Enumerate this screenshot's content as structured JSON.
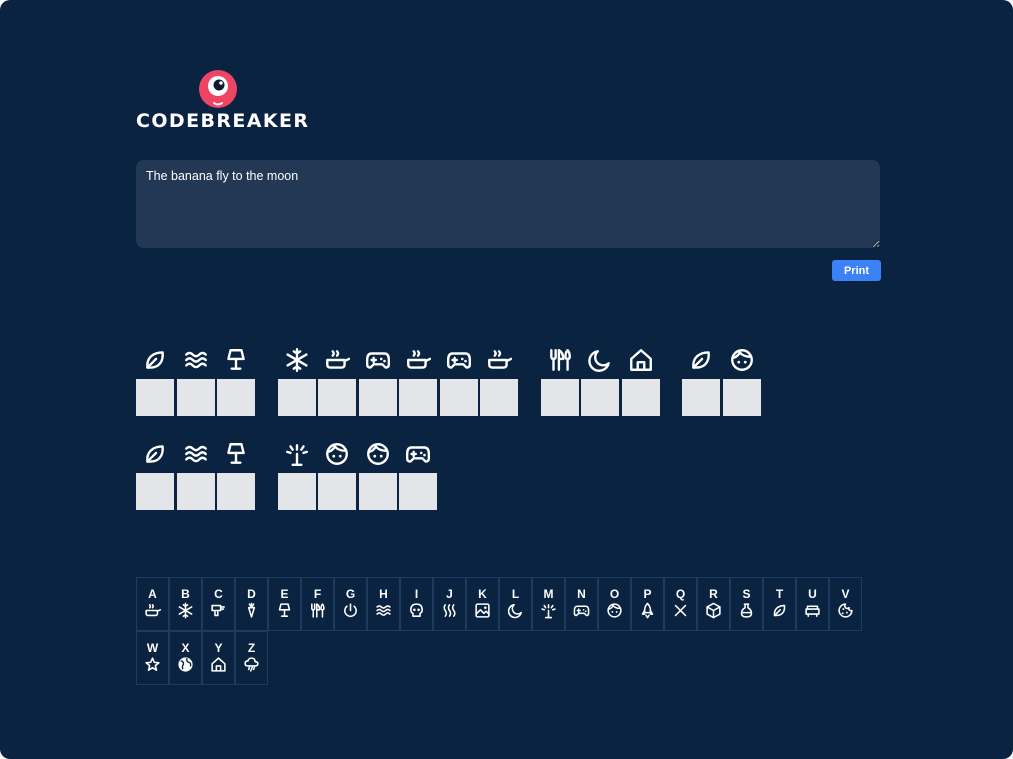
{
  "app": {
    "logo_text": "CODEBREAKER",
    "brand_color": "#ef4565",
    "background": "#092341"
  },
  "composer": {
    "message": "The banana fly to the moon",
    "print_label": "Print",
    "button_color": "#3b82f6"
  },
  "encoded_lines": [
    [
      [
        "leaf",
        "waves",
        "lamp"
      ],
      [
        "snowflake",
        "pot",
        "gamepad",
        "pot",
        "gamepad",
        "pot"
      ],
      [
        "cutlery",
        "moon",
        "house"
      ],
      [
        "leaf",
        "face"
      ]
    ],
    [
      [
        "leaf",
        "waves",
        "lamp"
      ],
      [
        "sprinkler",
        "face",
        "face",
        "gamepad"
      ]
    ]
  ],
  "cipher_key": [
    {
      "letter": "A",
      "icon": "pot"
    },
    {
      "letter": "B",
      "icon": "snowflake"
    },
    {
      "letter": "C",
      "icon": "drill"
    },
    {
      "letter": "D",
      "icon": "carrot"
    },
    {
      "letter": "E",
      "icon": "lamp"
    },
    {
      "letter": "F",
      "icon": "cutlery"
    },
    {
      "letter": "G",
      "icon": "power"
    },
    {
      "letter": "H",
      "icon": "waves"
    },
    {
      "letter": "I",
      "icon": "skull"
    },
    {
      "letter": "J",
      "icon": "heat"
    },
    {
      "letter": "K",
      "icon": "picture"
    },
    {
      "letter": "L",
      "icon": "moon"
    },
    {
      "letter": "M",
      "icon": "sprinkler"
    },
    {
      "letter": "N",
      "icon": "gamepad"
    },
    {
      "letter": "O",
      "icon": "face"
    },
    {
      "letter": "P",
      "icon": "rocket"
    },
    {
      "letter": "Q",
      "icon": "cross"
    },
    {
      "letter": "R",
      "icon": "cube"
    },
    {
      "letter": "S",
      "icon": "potion"
    },
    {
      "letter": "T",
      "icon": "leaf"
    },
    {
      "letter": "U",
      "icon": "sofa"
    },
    {
      "letter": "V",
      "icon": "cookie"
    },
    {
      "letter": "W",
      "icon": "star"
    },
    {
      "letter": "X",
      "icon": "globe"
    },
    {
      "letter": "Y",
      "icon": "house"
    },
    {
      "letter": "Z",
      "icon": "storm"
    }
  ]
}
